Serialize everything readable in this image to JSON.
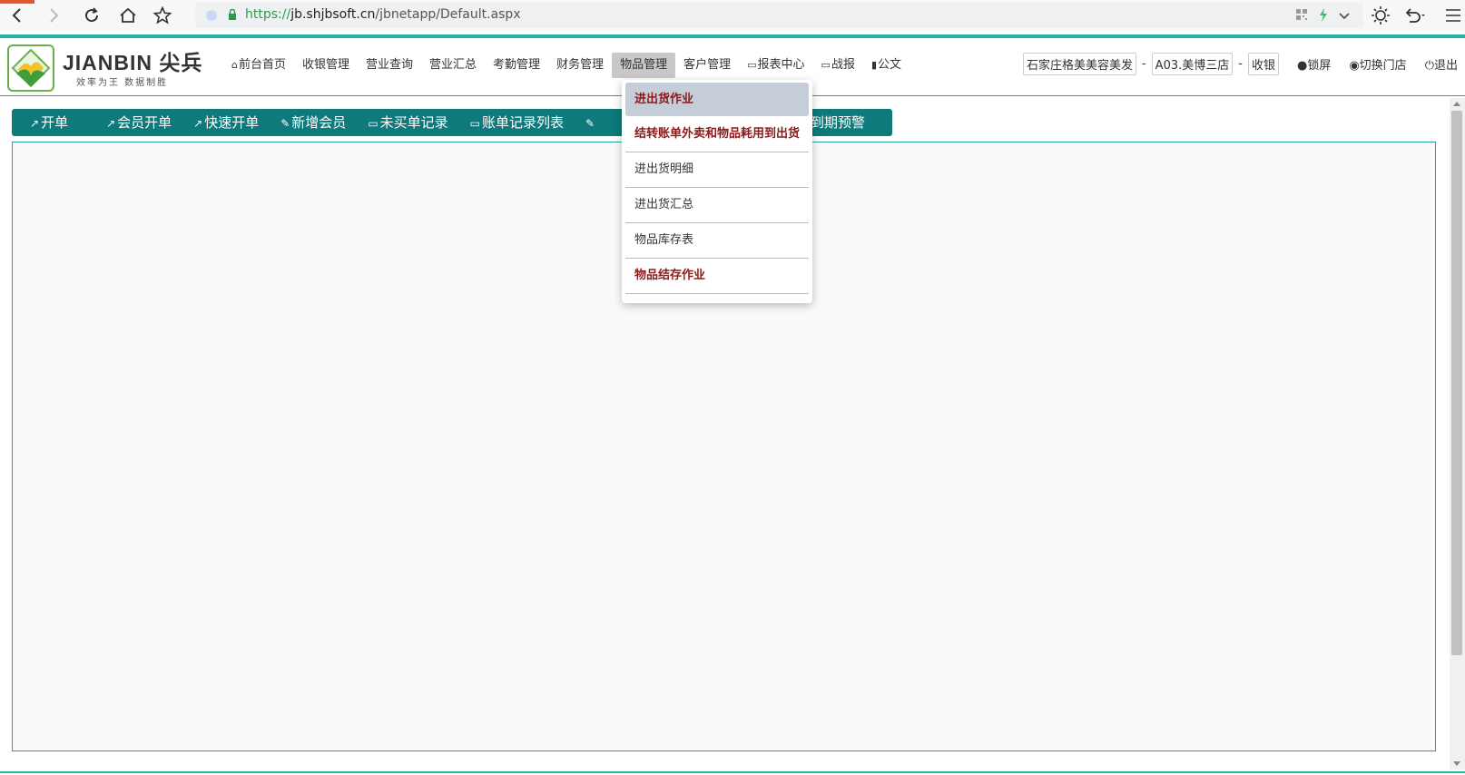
{
  "browser": {
    "url_scheme": "https://",
    "url_host": "jb.shjbsoft.cn",
    "url_path": "/jbnetapp/Default.aspx",
    "icons": [
      "back-icon",
      "forward-icon",
      "reload-icon",
      "home-icon",
      "star-icon",
      "lock-icon",
      "qr-icon",
      "lightning-icon",
      "chevron-down-icon",
      "brightness-icon",
      "undo-icon",
      "menu-icon"
    ]
  },
  "header": {
    "logo_text": "JIANBIN 尖兵",
    "logo_slogan": "效率为王  数据制胜",
    "menu": [
      {
        "label": "前台首页",
        "icon": "home-icon"
      },
      {
        "label": "收银管理"
      },
      {
        "label": "营业查询"
      },
      {
        "label": "营业汇总"
      },
      {
        "label": "考勤管理"
      },
      {
        "label": "财务管理"
      },
      {
        "label": "物品管理",
        "active": true
      },
      {
        "label": "客户管理"
      },
      {
        "label": "报表中心",
        "icon": "screen-icon"
      },
      {
        "label": "战报",
        "icon": "screen-icon"
      },
      {
        "label": "公文",
        "icon": "book-icon"
      }
    ],
    "company": "石家庄格美美容美发",
    "store": "A03.美博三店",
    "role": "收银",
    "separator": "-",
    "lock_label": "锁屏",
    "switch_store_label": "切换门店",
    "logout_label": "退出"
  },
  "toolbar": [
    {
      "label": "开单",
      "icon": "external-icon"
    },
    {
      "label": "会员开单",
      "icon": "external-icon"
    },
    {
      "label": "快速开单",
      "icon": "external-icon"
    },
    {
      "label": "新增会员",
      "icon": "edit-icon"
    },
    {
      "label": "未买单记录",
      "icon": "monitor-icon"
    },
    {
      "label": "账单记录列表",
      "icon": "monitor-icon"
    },
    {
      "label": "",
      "icon": "edit-icon"
    },
    {
      "label": "户到期预警",
      "icon": ""
    }
  ],
  "dropdown": {
    "items": [
      {
        "label": "进出货作业",
        "strong": true,
        "hover": true
      },
      {
        "label": "结转账单外卖和物品耗用到出货",
        "strong": true
      },
      {
        "label": "进出货明细"
      },
      {
        "label": "进出货汇总"
      },
      {
        "label": "物品库存表"
      },
      {
        "label": "物品结存作业",
        "strong": true
      }
    ]
  },
  "colors": {
    "accent": "#23b3aa",
    "toolbar_bg": "#0e7a7b",
    "dropdown_strong": "#8b1a1a"
  }
}
